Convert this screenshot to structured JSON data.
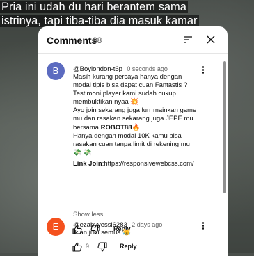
{
  "video": {
    "caption_lines": [
      "Pria ini udah du hari berantem sama",
      "istrinya, tapi tiba-tiba dia masuk kamar"
    ]
  },
  "comments_panel": {
    "title": "Comments",
    "count": "88",
    "sort_icon": "sort-icon",
    "close_icon": "close-icon"
  },
  "comments": [
    {
      "avatar_letter": "B",
      "avatar_color": "#5c6bc0",
      "author": "@Boylondon-t6p",
      "time": "0 seconds ago",
      "body_lines": [
        "Masih kurang percaya hanya dengan",
        "modal tipis bisa dapat cuan Fantastis ?",
        "Testimoni player kami sudah cukup",
        "membuktikan nyaa 💥",
        "Ayo join sekarang juga lurr mainkan game",
        "mu dan rasakan sekarang juga JEPE mu"
      ],
      "body_bold_prefix": "bersama ",
      "body_bold": "ROBOT88",
      "body_bold_suffix": "🔥",
      "body_lines_2": [
        "Hanya dengan modal 10K kamu bisa",
        "rasakan cuan tanpa limit di rekening mu",
        "💸 💸"
      ],
      "link_label": "Link Join",
      "link_url": ":https://responsivewebcss.com/",
      "show_less": "Show less",
      "like_count": "",
      "reply": "Reply"
    },
    {
      "avatar_letter": "E",
      "avatar_color": "#f4511e",
      "author": "@ezabyyessi6283",
      "time": "2 days ago",
      "body_lines": [
        "Iklan judi semua 😹"
      ],
      "like_count": "9",
      "reply": "Reply"
    }
  ]
}
